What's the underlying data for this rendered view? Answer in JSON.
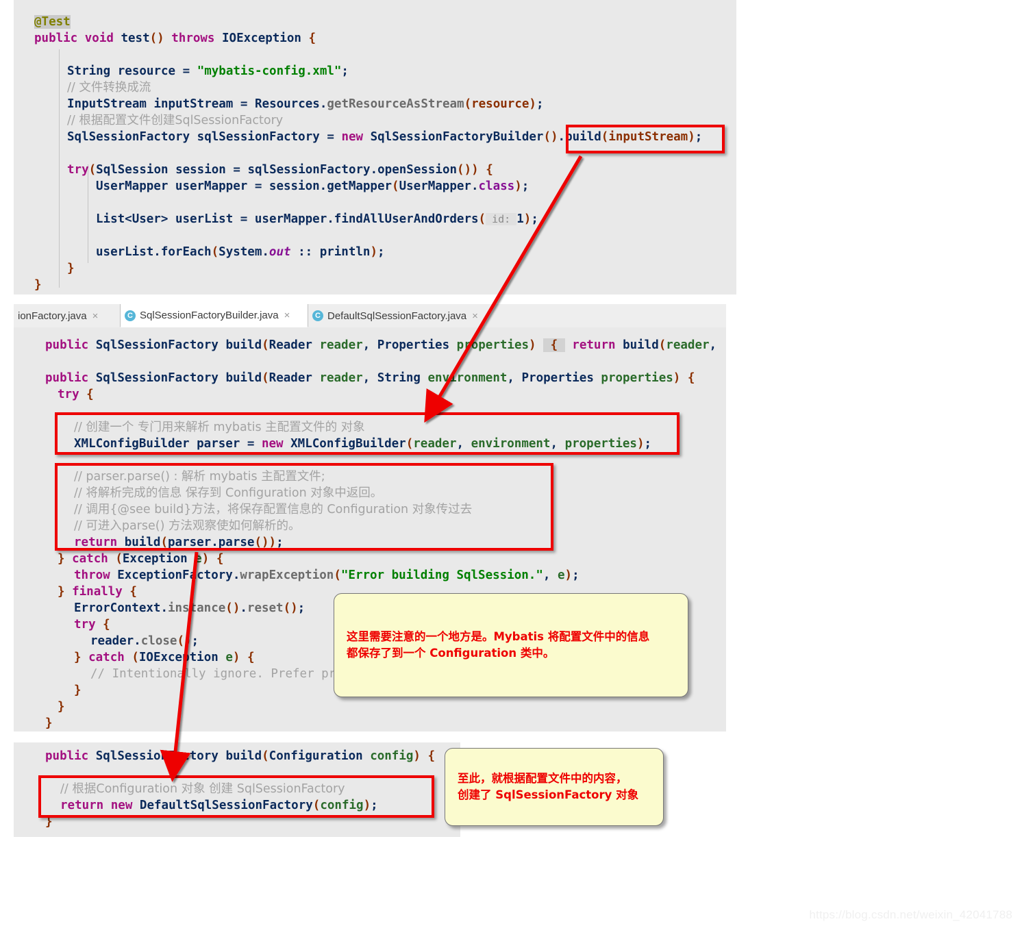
{
  "watermark": "https://blog.csdn.net/weixin_42041788",
  "top_panel": {
    "name": "test-method-editor",
    "lines": [
      "@Test",
      "public void test() throws IOException {",
      "",
      "    String resource = \"mybatis-config.xml\";",
      "    // 文件转换成流",
      "    InputStream inputStream = Resources.getResourceAsStream(resource);",
      "    // 根据配置文件创建SqlSessionFactory",
      "    SqlSessionFactory sqlSessionFactory = new SqlSessionFactoryBuilder().build(inputStream);",
      "",
      "    try(SqlSession session = sqlSessionFactory.openSession()) {",
      "        UserMapper userMapper = session.getMapper(UserMapper.class);",
      "",
      "        List<User> userList = userMapper.findAllUserAndOrders( id: 1);",
      "",
      "        userList.forEach(System.out :: println);",
      "    }",
      "}"
    ]
  },
  "tabs": [
    {
      "label": "ionFactory.java",
      "active": false,
      "has_icon": false,
      "close": "×"
    },
    {
      "label": "SqlSessionFactoryBuilder.java",
      "active": true,
      "has_icon": true,
      "icon": "class-icon",
      "icon_letter": "C",
      "close": "×"
    },
    {
      "label": "DefaultSqlSessionFactory.java",
      "active": false,
      "has_icon": true,
      "icon": "class-icon",
      "icon_letter": "C",
      "close": "×"
    }
  ],
  "mid_panel": {
    "name": "sql-session-factory-builder-editor",
    "lines": [
      "public SqlSessionFactory build(Reader reader, Properties properties) { return build(reader,",
      "",
      "public SqlSessionFactory build(Reader reader, String environment, Properties properties) {",
      "  try {",
      "",
      "    // 创建一个 专门用来解析 mybatis 主配置文件的 对象",
      "    XMLConfigBuilder parser = new XMLConfigBuilder(reader, environment, properties);",
      "",
      "    // parser.parse() : 解析 mybatis 主配置文件;",
      "    // 将解析完成的信息 保存到 Configuration 对象中返回。",
      "    // 调用{@see build}方法，将保存配置信息的 Configuration 对象传过去",
      "    // 可进入parse() 方法观察使如何解析的。",
      "    return build(parser.parse());",
      "  } catch (Exception e) {",
      "    throw ExceptionFactory.wrapException(\"Error building SqlSession.\", e);",
      "  } finally {",
      "    ErrorContext.instance().reset();",
      "    try {",
      "      reader.close();",
      "    } catch (IOException e) {",
      "      // Intentionally ignore. Prefer pr",
      "    }",
      "  }",
      "}"
    ]
  },
  "bottom_panel": {
    "name": "build-configuration-editor",
    "lines": [
      "public SqlSessionFactory build(Configuration config) {",
      "",
      "  // 根据Configuration 对象 创建 SqlSessionFactory",
      "  return new DefaultSqlSessionFactory(config);",
      "}"
    ]
  },
  "callouts": [
    {
      "name": "callout-configuration-note",
      "text": "这里需要注意的一个地方是。Mybatis 将配置文件中的信息\n都保存了到一个 Configuration 类中。"
    },
    {
      "name": "callout-factory-created",
      "text": "至此，就根据配置文件中的内容，\n创建了 SqlSessionFactory 对象"
    }
  ],
  "annotations": {
    "highlight_boxes": [
      {
        "name": "highlight-build-input-stream"
      },
      {
        "name": "highlight-xml-config-builder"
      },
      {
        "name": "highlight-return-build-parser-parse"
      },
      {
        "name": "highlight-return-default-sql-session-factory"
      }
    ],
    "arrows": [
      {
        "name": "arrow-build-to-xmlconfigbuilder"
      },
      {
        "name": "arrow-returnbuild-to-buildconfig"
      }
    ]
  },
  "colors": {
    "accent_red": "#ee0000",
    "callout_bg": "#fbfbce",
    "editor_bg": "#e9e9e9",
    "keyword": "#a31080",
    "string": "#008000",
    "comment": "#a3a3a3"
  }
}
